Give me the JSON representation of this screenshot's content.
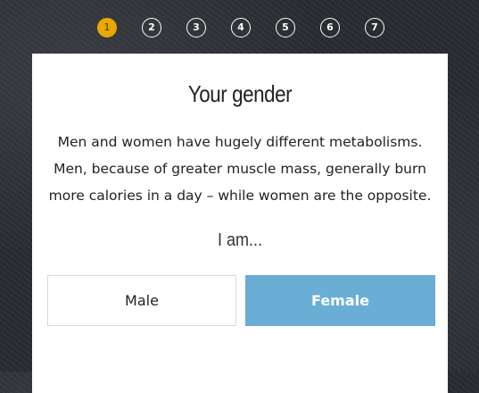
{
  "steps": [
    "1",
    "2",
    "3",
    "4",
    "5",
    "6",
    "7"
  ],
  "active_step": "1",
  "card": {
    "title": "Your gender",
    "description_lines": [
      "Men and women have hugely different metabolisms.",
      "Men, because of greater muscle mass, generally burn",
      "more calories in a day – while women are the opposite."
    ],
    "prompt": "I am...",
    "options": [
      {
        "label": "Male",
        "selected": false
      },
      {
        "label": "Female",
        "selected": true
      }
    ]
  },
  "colors": {
    "active_step": "#e9a800",
    "selected_option": "#6aaed6",
    "background": "#2a2d31"
  }
}
